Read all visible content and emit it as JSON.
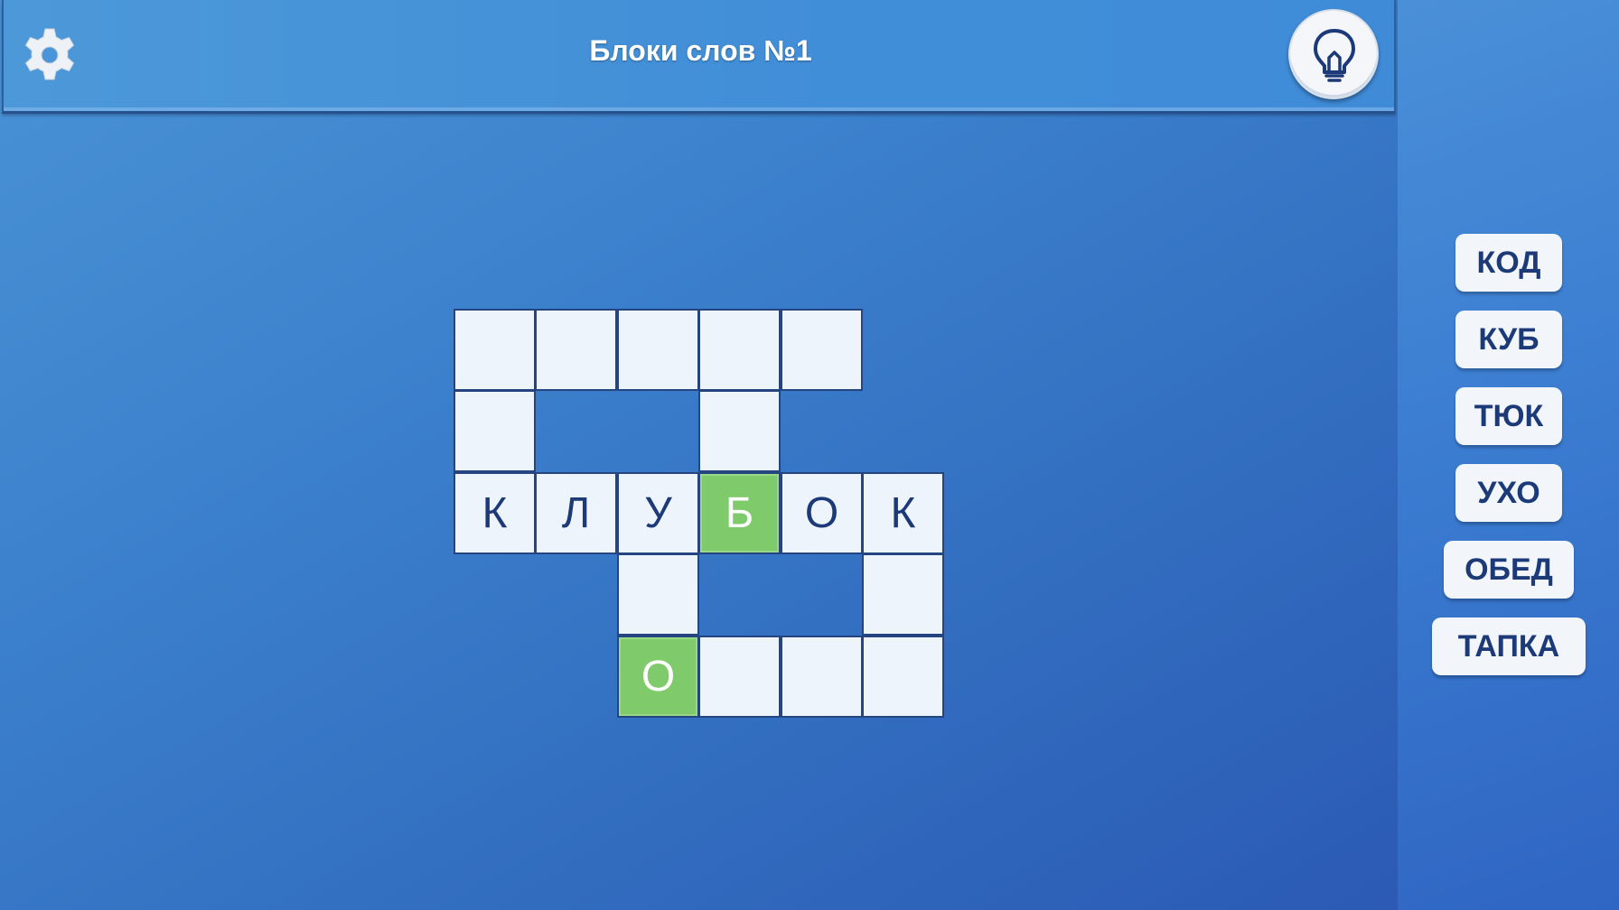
{
  "header": {
    "title": "Блоки слов №1",
    "settings_icon": "gear-icon",
    "hint_icon": "lightbulb-icon"
  },
  "grid": {
    "columns": 6,
    "rows": 5,
    "cells": [
      {
        "row": 0,
        "col": 0,
        "letter": "",
        "highlighted": false
      },
      {
        "row": 0,
        "col": 1,
        "letter": "",
        "highlighted": false
      },
      {
        "row": 0,
        "col": 2,
        "letter": "",
        "highlighted": false
      },
      {
        "row": 0,
        "col": 3,
        "letter": "",
        "highlighted": false
      },
      {
        "row": 0,
        "col": 4,
        "letter": "",
        "highlighted": false
      },
      {
        "row": 1,
        "col": 0,
        "letter": "",
        "highlighted": false
      },
      {
        "row": 1,
        "col": 3,
        "letter": "",
        "highlighted": false
      },
      {
        "row": 2,
        "col": 0,
        "letter": "К",
        "highlighted": false
      },
      {
        "row": 2,
        "col": 1,
        "letter": "Л",
        "highlighted": false
      },
      {
        "row": 2,
        "col": 2,
        "letter": "У",
        "highlighted": false
      },
      {
        "row": 2,
        "col": 3,
        "letter": "Б",
        "highlighted": true
      },
      {
        "row": 2,
        "col": 4,
        "letter": "О",
        "highlighted": false
      },
      {
        "row": 2,
        "col": 5,
        "letter": "К",
        "highlighted": false
      },
      {
        "row": 3,
        "col": 2,
        "letter": "",
        "highlighted": false
      },
      {
        "row": 3,
        "col": 5,
        "letter": "",
        "highlighted": false
      },
      {
        "row": 4,
        "col": 2,
        "letter": "О",
        "highlighted": true
      },
      {
        "row": 4,
        "col": 3,
        "letter": "",
        "highlighted": false
      },
      {
        "row": 4,
        "col": 4,
        "letter": "",
        "highlighted": false
      },
      {
        "row": 4,
        "col": 5,
        "letter": "",
        "highlighted": false
      }
    ]
  },
  "words": [
    "КОД",
    "КУБ",
    "ТЮК",
    "УХО",
    "ОБЕД",
    "ТАПКА"
  ],
  "colors": {
    "cell_bg": "#eef4fb",
    "cell_highlight": "#7fcb6b",
    "letter_text": "#1c3a78",
    "grid_border": "#24457f"
  }
}
